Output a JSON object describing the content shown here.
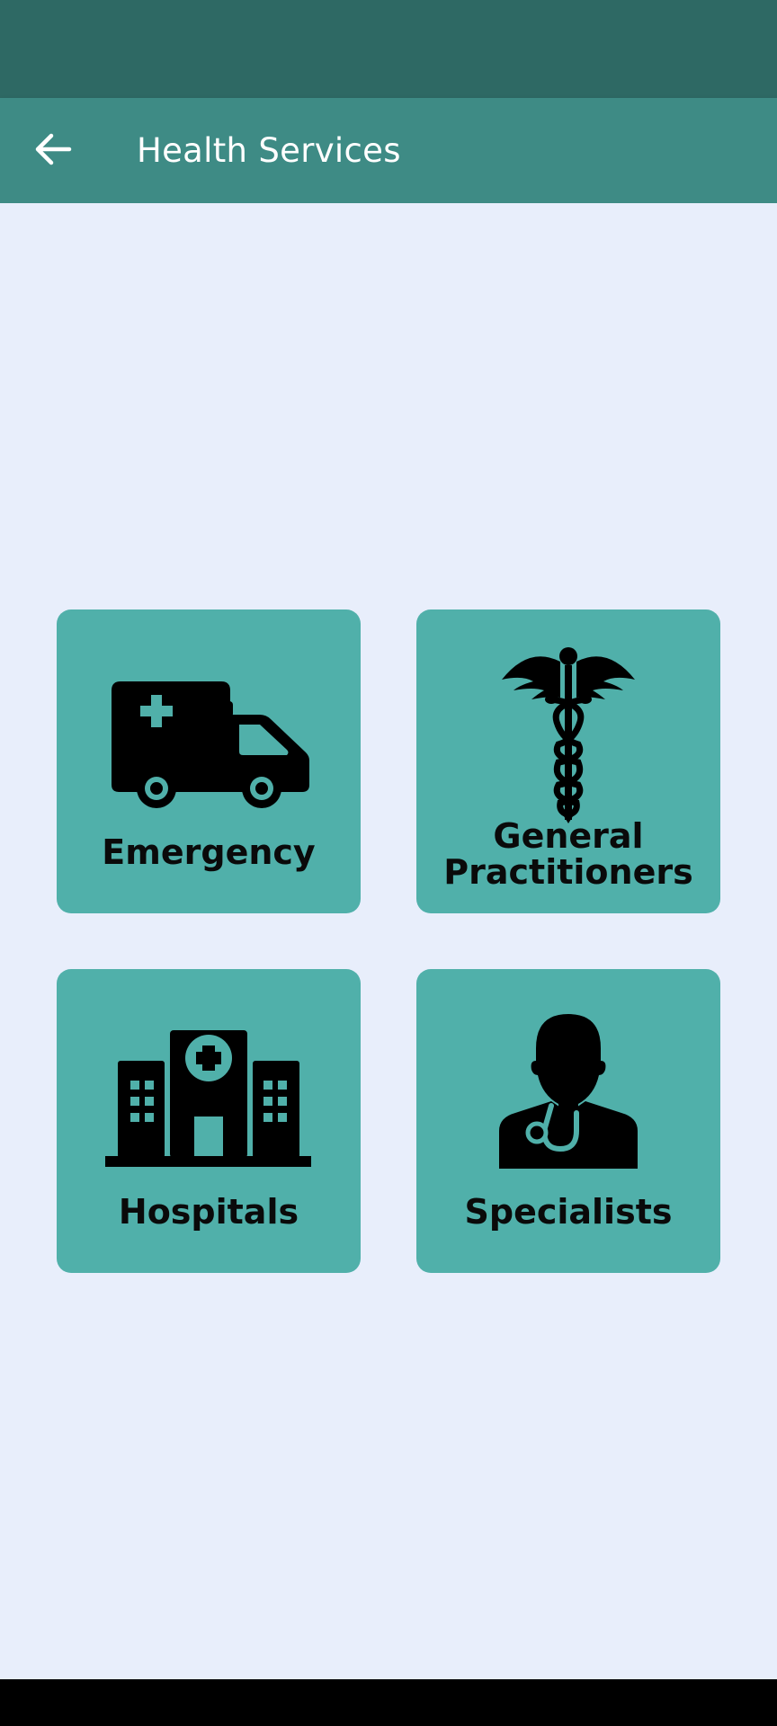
{
  "app_bar": {
    "title": "Health Services",
    "back_icon": "arrow-left-icon"
  },
  "colors": {
    "status_bar": "#2e6964",
    "app_bar": "#3e8b85",
    "background": "#e8eefb",
    "card": "#50b0aa"
  },
  "services": [
    {
      "label": "Emergency",
      "icon": "ambulance-icon"
    },
    {
      "label_line1": "General",
      "label_line2": "Practitioners",
      "icon": "caduceus-icon"
    },
    {
      "label": "Hospitals",
      "icon": "hospital-building-icon"
    },
    {
      "label": "Specialists",
      "icon": "doctor-stethoscope-icon"
    }
  ]
}
